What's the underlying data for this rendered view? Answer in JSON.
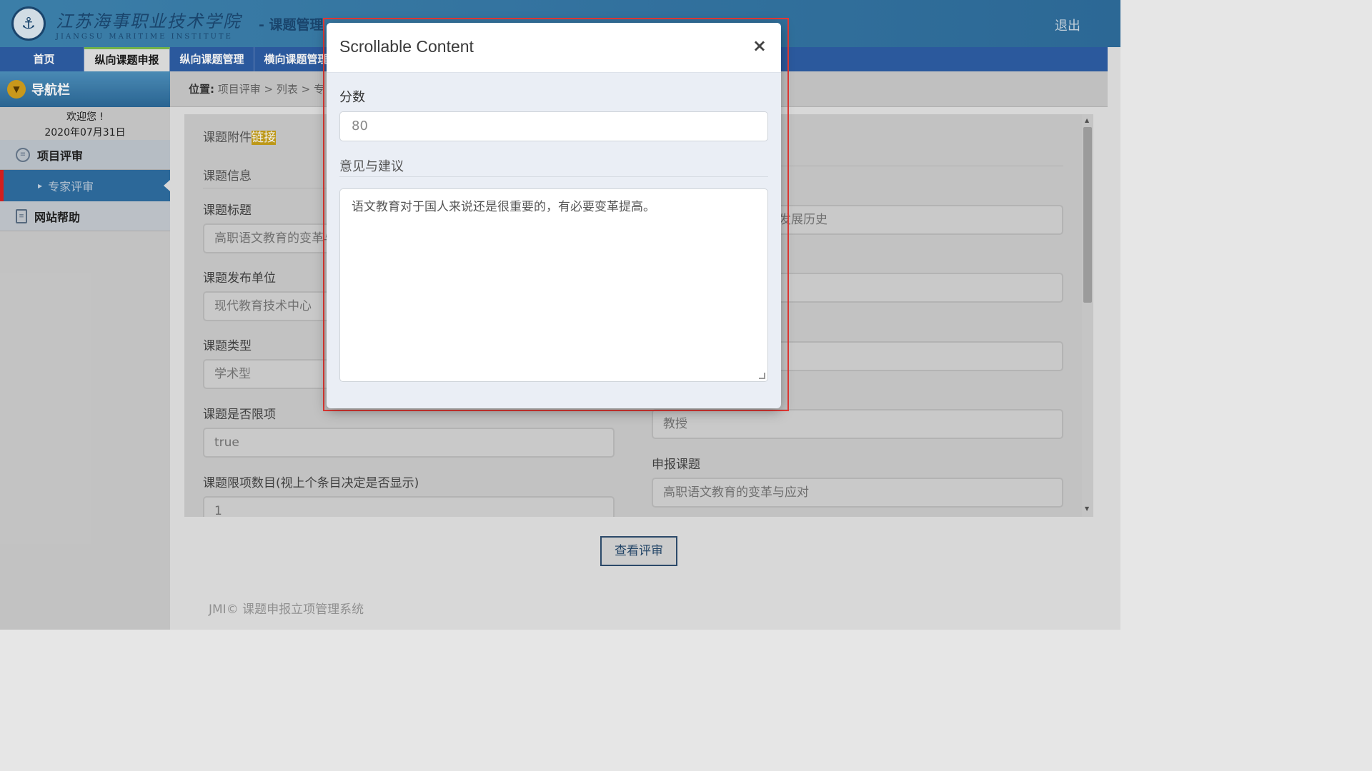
{
  "header": {
    "logo_cn": "江苏海事职业技术学院",
    "logo_en": "JIANGSU MARITIME INSTITUTE",
    "subtitle": "- 课题管理",
    "logout": "退出"
  },
  "nav": {
    "tabs": [
      {
        "label": "首页"
      },
      {
        "label": "纵向课题申报"
      },
      {
        "label": "纵向课题管理"
      },
      {
        "label": "横向课题管理"
      }
    ]
  },
  "sidebar": {
    "title": "导航栏",
    "welcome": "欢迎您 !",
    "date": "2020年07月31日",
    "groups": [
      {
        "label": "项目评审"
      },
      {
        "label": "网站帮助"
      }
    ],
    "items": [
      {
        "label": "专家评审"
      }
    ]
  },
  "breadcrumb": {
    "label": "位置:",
    "path": "项目评审 > 列表 > 专"
  },
  "form": {
    "attachment_label": "课题附件",
    "attachment_link": "链接",
    "section_info": "课题信息",
    "title_label": "课题标题",
    "title_value": "高职语文教育的变革与应对",
    "unit_label": "课题发布单位",
    "unit_value": "现代教育技术中心",
    "type_label": "课题类型",
    "type_value": "学术型",
    "limited_label": "课题是否限项",
    "limited_value": "true",
    "limit_count_label": "课题限项数目(视上个条目决定是否显示)",
    "limit_count_value": "1",
    "right_value_1": "发展历史",
    "right_value_2": "",
    "right_value_3": "",
    "title_rank_value": "教授",
    "applied_label": "申报课题",
    "applied_value": "高职语文教育的变革与应对"
  },
  "buttons": {
    "view_review": "查看评审"
  },
  "footer": "JMI© 课题申报立项管理系统",
  "modal": {
    "title": "Scrollable Content",
    "close": "×",
    "score_label": "分数",
    "score_value": "80",
    "comment_label": "意见与建议",
    "comment_value": "语文教育对于国人来说还是很重要的，有必要变革提高。"
  }
}
